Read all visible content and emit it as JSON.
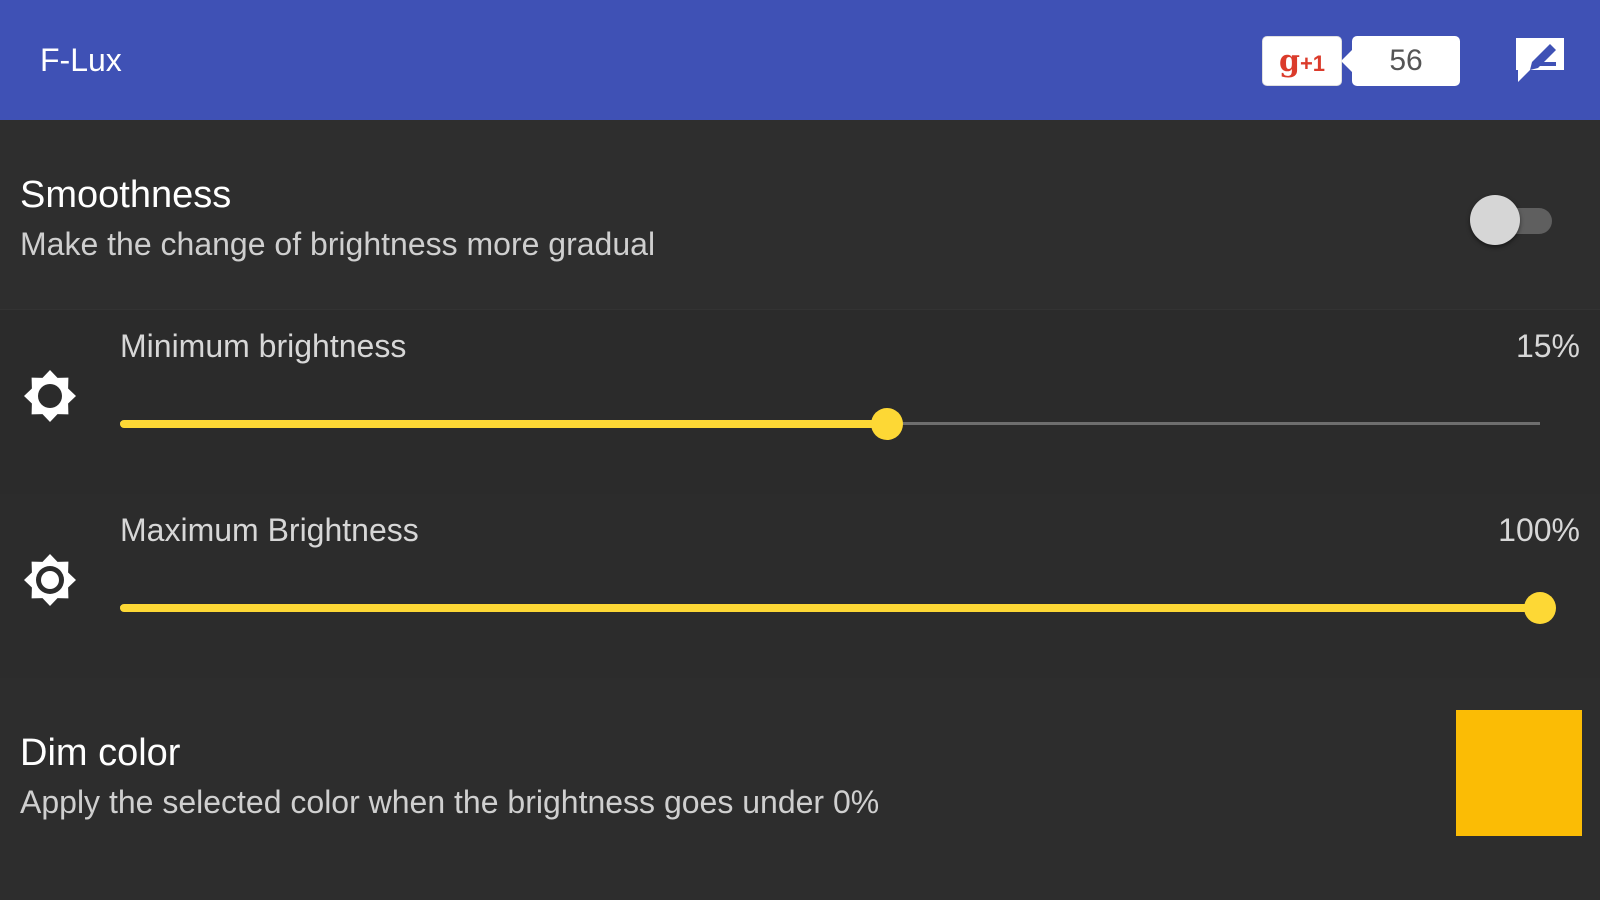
{
  "appbar": {
    "title": "F-Lux",
    "gplus_label": "g",
    "gplus_suffix": "+1",
    "gplus_count": "56",
    "feedback_icon": "edit-note-icon"
  },
  "smoothness": {
    "title": "Smoothness",
    "summary": "Make the change of brightness more gradual",
    "enabled": false
  },
  "min_brightness": {
    "title": "Minimum brightness",
    "value_text": "15%",
    "fraction": 0.54,
    "icon": "brightness-low-icon"
  },
  "max_brightness": {
    "title": "Maximum Brightness",
    "value_text": "100%",
    "fraction": 1.0,
    "icon": "brightness-high-icon"
  },
  "dim_color": {
    "title": "Dim color",
    "summary": "Apply the selected color when the brightness goes under 0%",
    "color": "#fbbc05"
  },
  "colors": {
    "appbar": "#3f51b5",
    "accent": "#fdd835",
    "background": "#2d2d2d"
  }
}
